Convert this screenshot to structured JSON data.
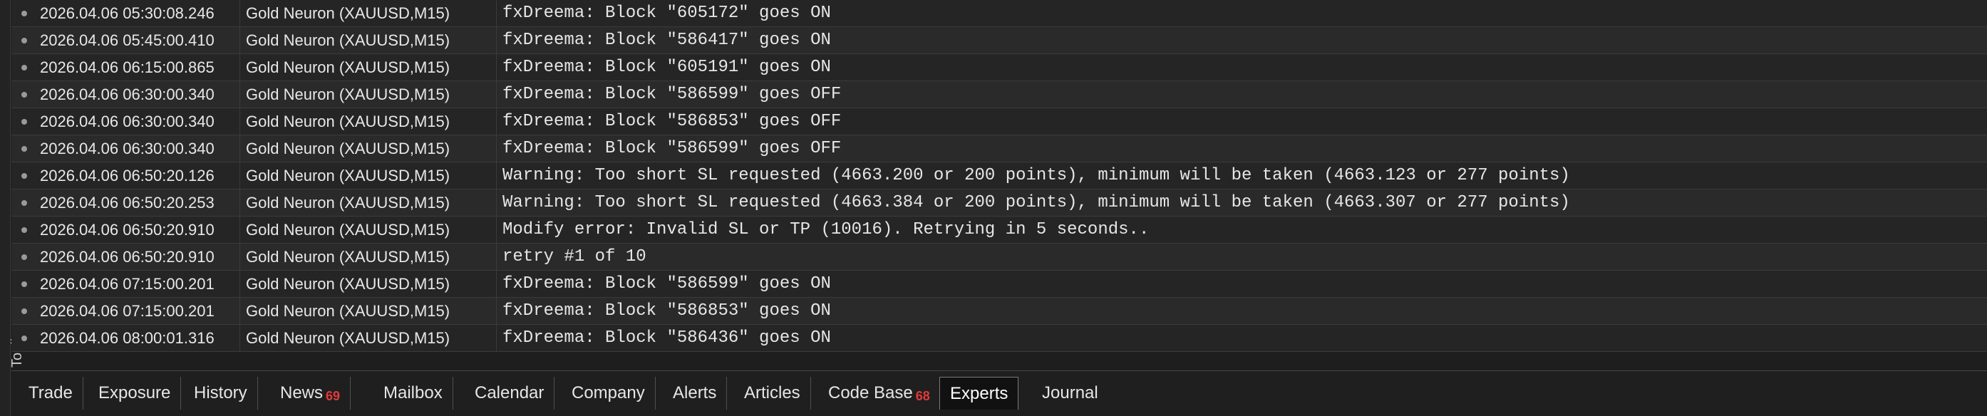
{
  "side_panel": {
    "label": "Toolbox"
  },
  "log": {
    "rows": [
      {
        "time": "2026.04.06 05:30:08.246",
        "source": "Gold Neuron (XAUUSD,M15)",
        "message": "fxDreema: Block \"605172\" goes ON"
      },
      {
        "time": "2026.04.06 05:45:00.410",
        "source": "Gold Neuron (XAUUSD,M15)",
        "message": "fxDreema: Block \"586417\" goes ON"
      },
      {
        "time": "2026.04.06 06:15:00.865",
        "source": "Gold Neuron (XAUUSD,M15)",
        "message": "fxDreema: Block \"605191\" goes ON"
      },
      {
        "time": "2026.04.06 06:30:00.340",
        "source": "Gold Neuron (XAUUSD,M15)",
        "message": "fxDreema: Block \"586599\" goes OFF"
      },
      {
        "time": "2026.04.06 06:30:00.340",
        "source": "Gold Neuron (XAUUSD,M15)",
        "message": "fxDreema: Block \"586853\" goes OFF"
      },
      {
        "time": "2026.04.06 06:30:00.340",
        "source": "Gold Neuron (XAUUSD,M15)",
        "message": "fxDreema: Block \"586599\" goes OFF"
      },
      {
        "time": "2026.04.06 06:50:20.126",
        "source": "Gold Neuron (XAUUSD,M15)",
        "message": "Warning: Too short SL requested (4663.200 or 200 points), minimum will be taken (4663.123 or 277 points)"
      },
      {
        "time": "2026.04.06 06:50:20.253",
        "source": "Gold Neuron (XAUUSD,M15)",
        "message": "Warning: Too short SL requested (4663.384 or 200 points), minimum will be taken (4663.307 or 277 points)"
      },
      {
        "time": "2026.04.06 06:50:20.910",
        "source": "Gold Neuron (XAUUSD,M15)",
        "message": "Modify error: Invalid SL or TP (10016). Retrying in 5 seconds.."
      },
      {
        "time": "2026.04.06 06:50:20.910",
        "source": "Gold Neuron (XAUUSD,M15)",
        "message": "retry #1 of 10"
      },
      {
        "time": "2026.04.06 07:15:00.201",
        "source": "Gold Neuron (XAUUSD,M15)",
        "message": "fxDreema: Block \"586599\" goes ON"
      },
      {
        "time": "2026.04.06 07:15:00.201",
        "source": "Gold Neuron (XAUUSD,M15)",
        "message": "fxDreema: Block \"586853\" goes ON"
      },
      {
        "time": "2026.04.06 08:00:01.316",
        "source": "Gold Neuron (XAUUSD,M15)",
        "message": "fxDreema: Block \"586436\" goes ON"
      }
    ]
  },
  "tabs": [
    {
      "label": "Trade",
      "badge": "",
      "active": false
    },
    {
      "label": "Exposure",
      "badge": "",
      "active": false
    },
    {
      "label": "History",
      "badge": "",
      "active": false
    },
    {
      "label": "News",
      "badge": "69",
      "active": false
    },
    {
      "label": "Mailbox",
      "badge": "",
      "active": false
    },
    {
      "label": "Calendar",
      "badge": "",
      "active": false
    },
    {
      "label": "Company",
      "badge": "",
      "active": false
    },
    {
      "label": "Alerts",
      "badge": "",
      "active": false
    },
    {
      "label": "Articles",
      "badge": "",
      "active": false
    },
    {
      "label": "Code Base",
      "badge": "68",
      "active": false
    },
    {
      "label": "Experts",
      "badge": "",
      "active": true
    },
    {
      "label": "Journal",
      "badge": "",
      "active": false
    }
  ]
}
